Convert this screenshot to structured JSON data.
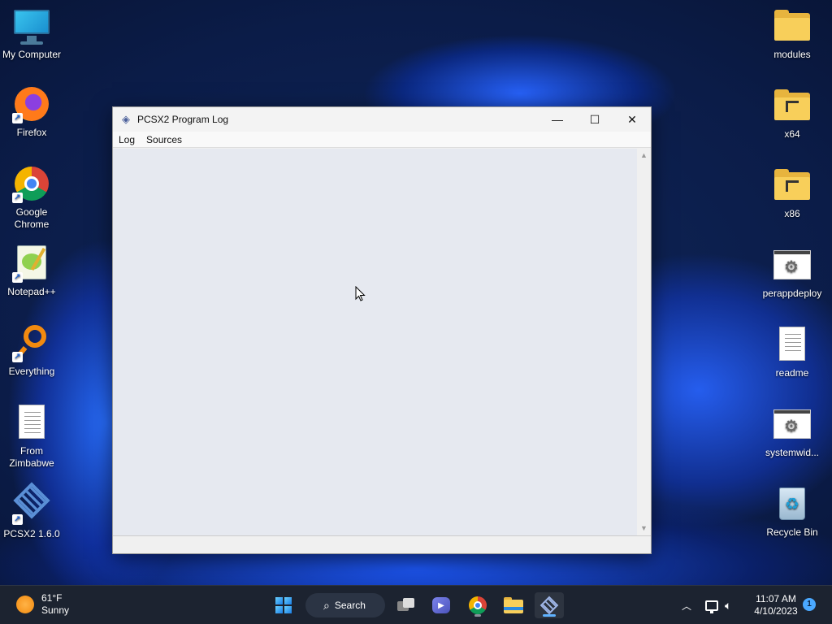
{
  "desktop": {
    "left_icons": [
      {
        "label": "My Computer"
      },
      {
        "label": "Firefox"
      },
      {
        "label": "Google Chrome"
      },
      {
        "label": "Notepad++"
      },
      {
        "label": "Everything"
      },
      {
        "label": "From Zimbabwe"
      },
      {
        "label": "PCSX2 1.6.0"
      }
    ],
    "right_icons": [
      {
        "label": "modules"
      },
      {
        "label": "x64"
      },
      {
        "label": "x86"
      },
      {
        "label": "perappdeploy"
      },
      {
        "label": "readme"
      },
      {
        "label": "systemwid..."
      },
      {
        "label": "Recycle Bin"
      }
    ]
  },
  "window": {
    "title": "PCSX2 Program Log",
    "controls": {
      "minimize": "—",
      "maximize": "☐",
      "close": "✕"
    },
    "menu": [
      "Log",
      "Sources"
    ]
  },
  "taskbar": {
    "weather": {
      "temp": "61°F",
      "condition": "Sunny"
    },
    "search_label": "Search",
    "clock": {
      "time": "11:07 AM",
      "date": "4/10/2023"
    },
    "notification_count": "1",
    "tray_icons": [
      "chevron-up-icon",
      "network-icon",
      "volume-icon"
    ]
  },
  "colors": {
    "log_background": "#e6e9f0",
    "taskbar": "#1c2330",
    "accent": "#5fb2ff"
  }
}
